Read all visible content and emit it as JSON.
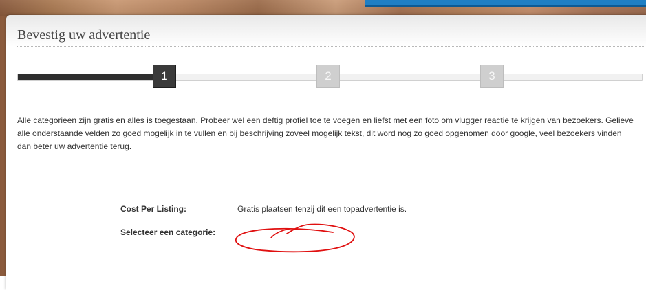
{
  "page": {
    "title": "Bevestig uw advertentie"
  },
  "progress": {
    "steps": [
      {
        "label": "1",
        "state": "active"
      },
      {
        "label": "2",
        "state": "inactive"
      },
      {
        "label": "3",
        "state": "inactive"
      }
    ],
    "completed_fraction": 0.22
  },
  "intro": {
    "text": "Alle categorieen zijn gratis en alles is toegestaan. Probeer wel een deftig profiel toe te voegen en liefst met een foto om vlugger reactie te krijgen van bezoekers. Gelieve alle onderstaande velden zo goed mogelijk in te vullen en bij beschrijving zoveel mogelijk tekst, dit word nog zo goed opgenomen door google, veel bezoekers vinden dan beter uw advertentie terug."
  },
  "fields": {
    "cost_label": "Cost Per Listing:",
    "cost_value": "Gratis plaatsen tenzij dit een topadvertentie is.",
    "category_label": "Selecteer een categorie:"
  },
  "colors": {
    "accent_bar": "#1f7fc4",
    "active_step": "#3a3a3a",
    "inactive_step": "#cfcfcf",
    "scribble": "#e01010"
  }
}
